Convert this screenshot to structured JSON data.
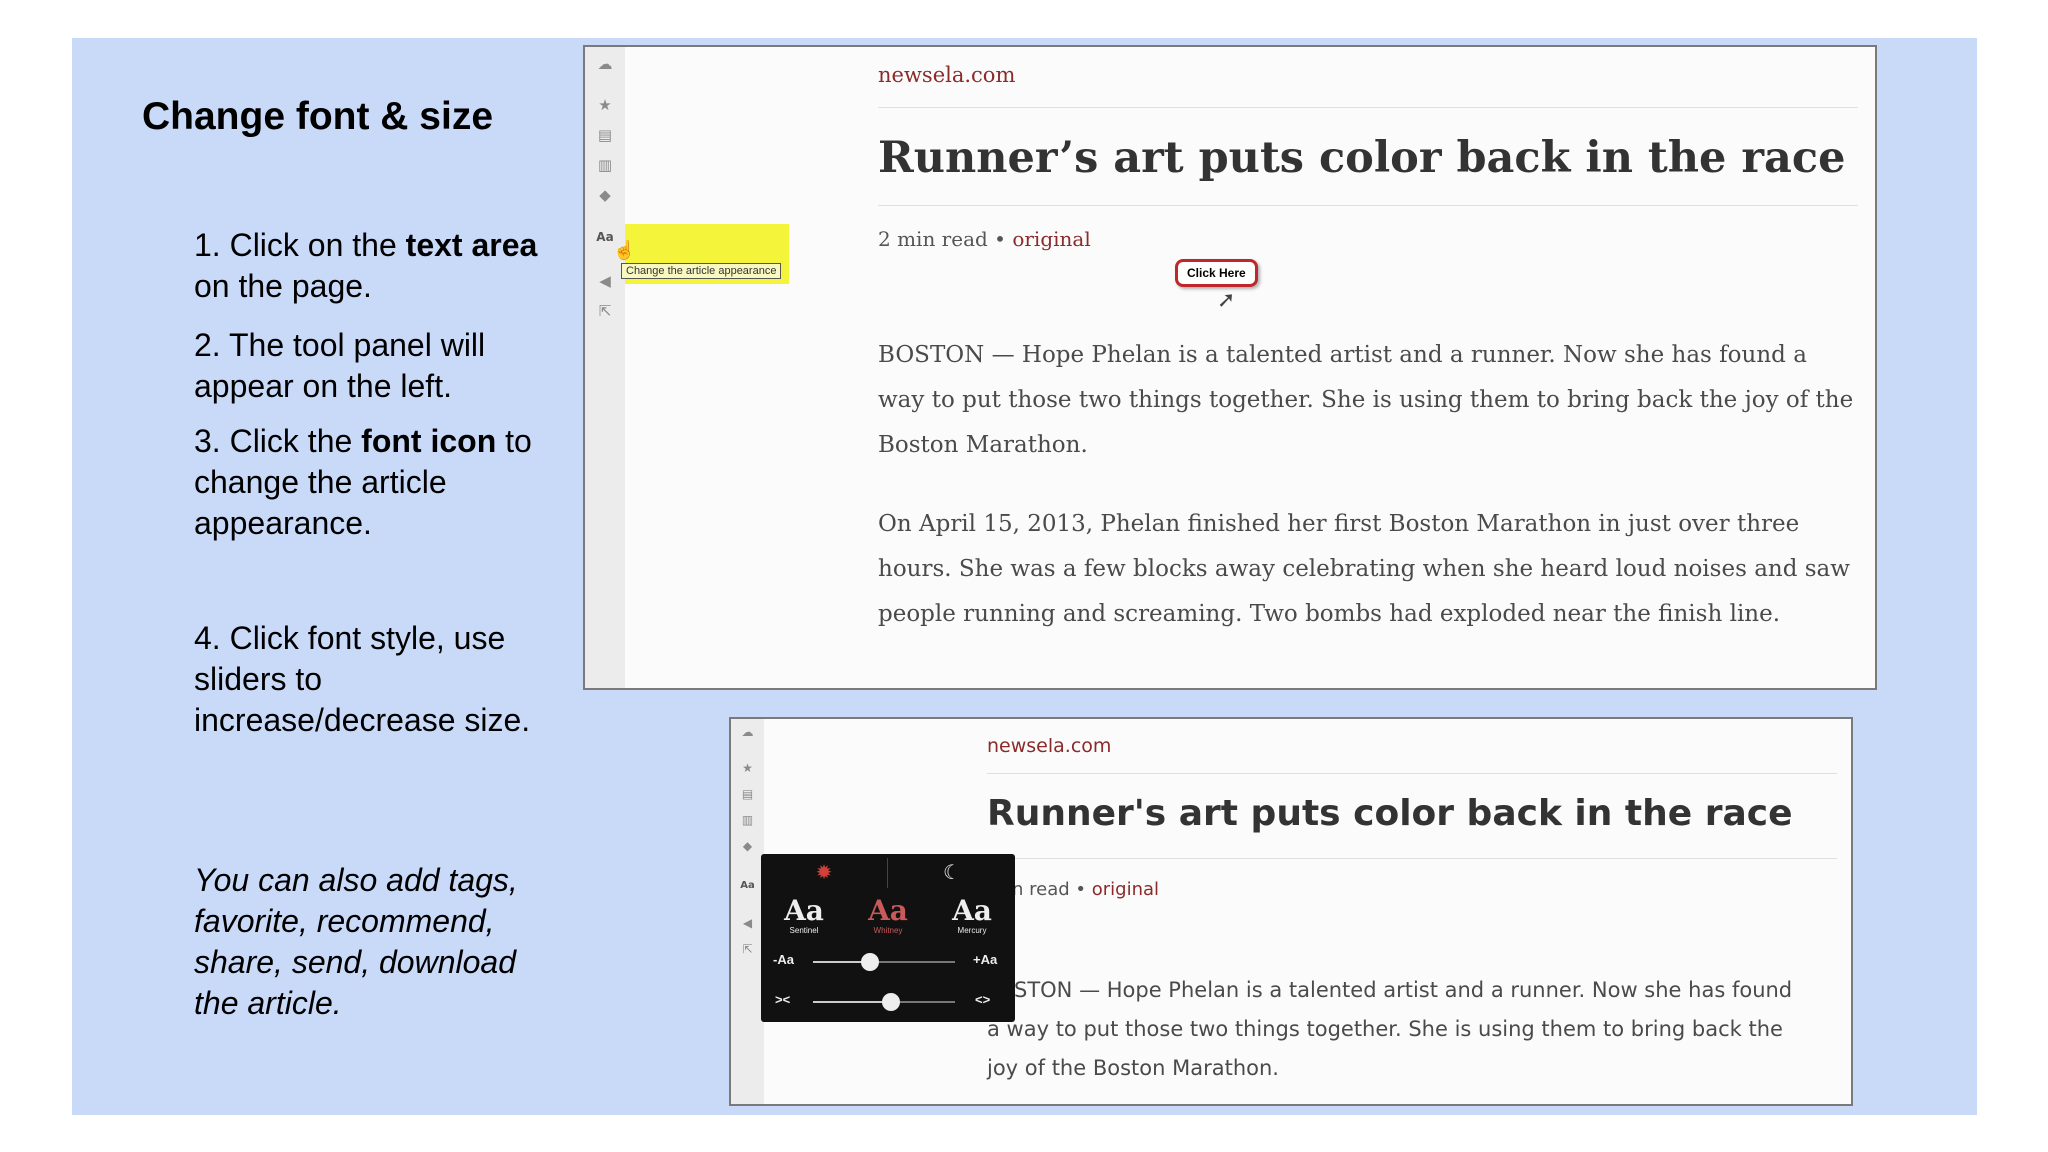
{
  "slide": {
    "title": "Change font & size",
    "steps": [
      {
        "pre": "1. Click on the ",
        "bold": "text area",
        "post": " on the page."
      },
      {
        "pre": "2. The tool panel will appear on the left.",
        "bold": "",
        "post": ""
      },
      {
        "pre": "3. Click the ",
        "bold": "font icon",
        "post": " to change the article appearance."
      },
      {
        "pre": "4. Click font style, use sliders to increase/decrease size.",
        "bold": "",
        "post": ""
      }
    ],
    "note": "You can also add tags, favorite, recommend, share, send, download the article."
  },
  "screenshot1": {
    "site": "newsela.com",
    "headline": "Runner’s art puts color back in the race",
    "read_time": "2 min read",
    "separator": "•",
    "label": "original",
    "tooltip": "Change the article appearance",
    "click_here": "Click Here",
    "toolbar_font_label": "Aa",
    "paragraphs": [
      "BOSTON — Hope Phelan is a talented artist and a runner. Now she has found a way to put those two things together. She is using them to bring back the joy of the Boston Marathon.",
      "On April 15, 2013, Phelan finished her first Boston Marathon in just over three hours. She was a few blocks away celebrating when she heard loud noises and saw people running and screaming. Two bombs had exploded near the finish line."
    ],
    "toolbar_icons": [
      "cloud-icon",
      "star-icon",
      "archive-icon",
      "trash-icon",
      "tag-icon",
      "font-icon",
      "megaphone-icon",
      "share-icon"
    ]
  },
  "screenshot2": {
    "site": "newsela.com",
    "headline": "Runner's art puts color back in the race",
    "read_time": "in read",
    "separator": "•",
    "label": "original",
    "toolbar_font_label": "Aa",
    "paragraph_lines": [
      "STON — Hope Phelan is a talented artist and a runner. Now she has found",
      "a way to put those two things together. She is using them to bring back the",
      "joy of the Boston Marathon."
    ],
    "panel": {
      "fonts": [
        {
          "label": "Aa",
          "name": "Sentinel",
          "color": "#eeeeee"
        },
        {
          "label": "Aa",
          "name": "Whitney",
          "color": "#c85a5a"
        },
        {
          "label": "Aa",
          "name": "Mercury",
          "color": "#eeeeee"
        }
      ],
      "size_slider": {
        "min_label": "-Aa",
        "max_label": "+Aa",
        "value": 0.4
      },
      "width_slider": {
        "min_label": "><",
        "max_label": "<>",
        "value": 0.55
      }
    }
  }
}
